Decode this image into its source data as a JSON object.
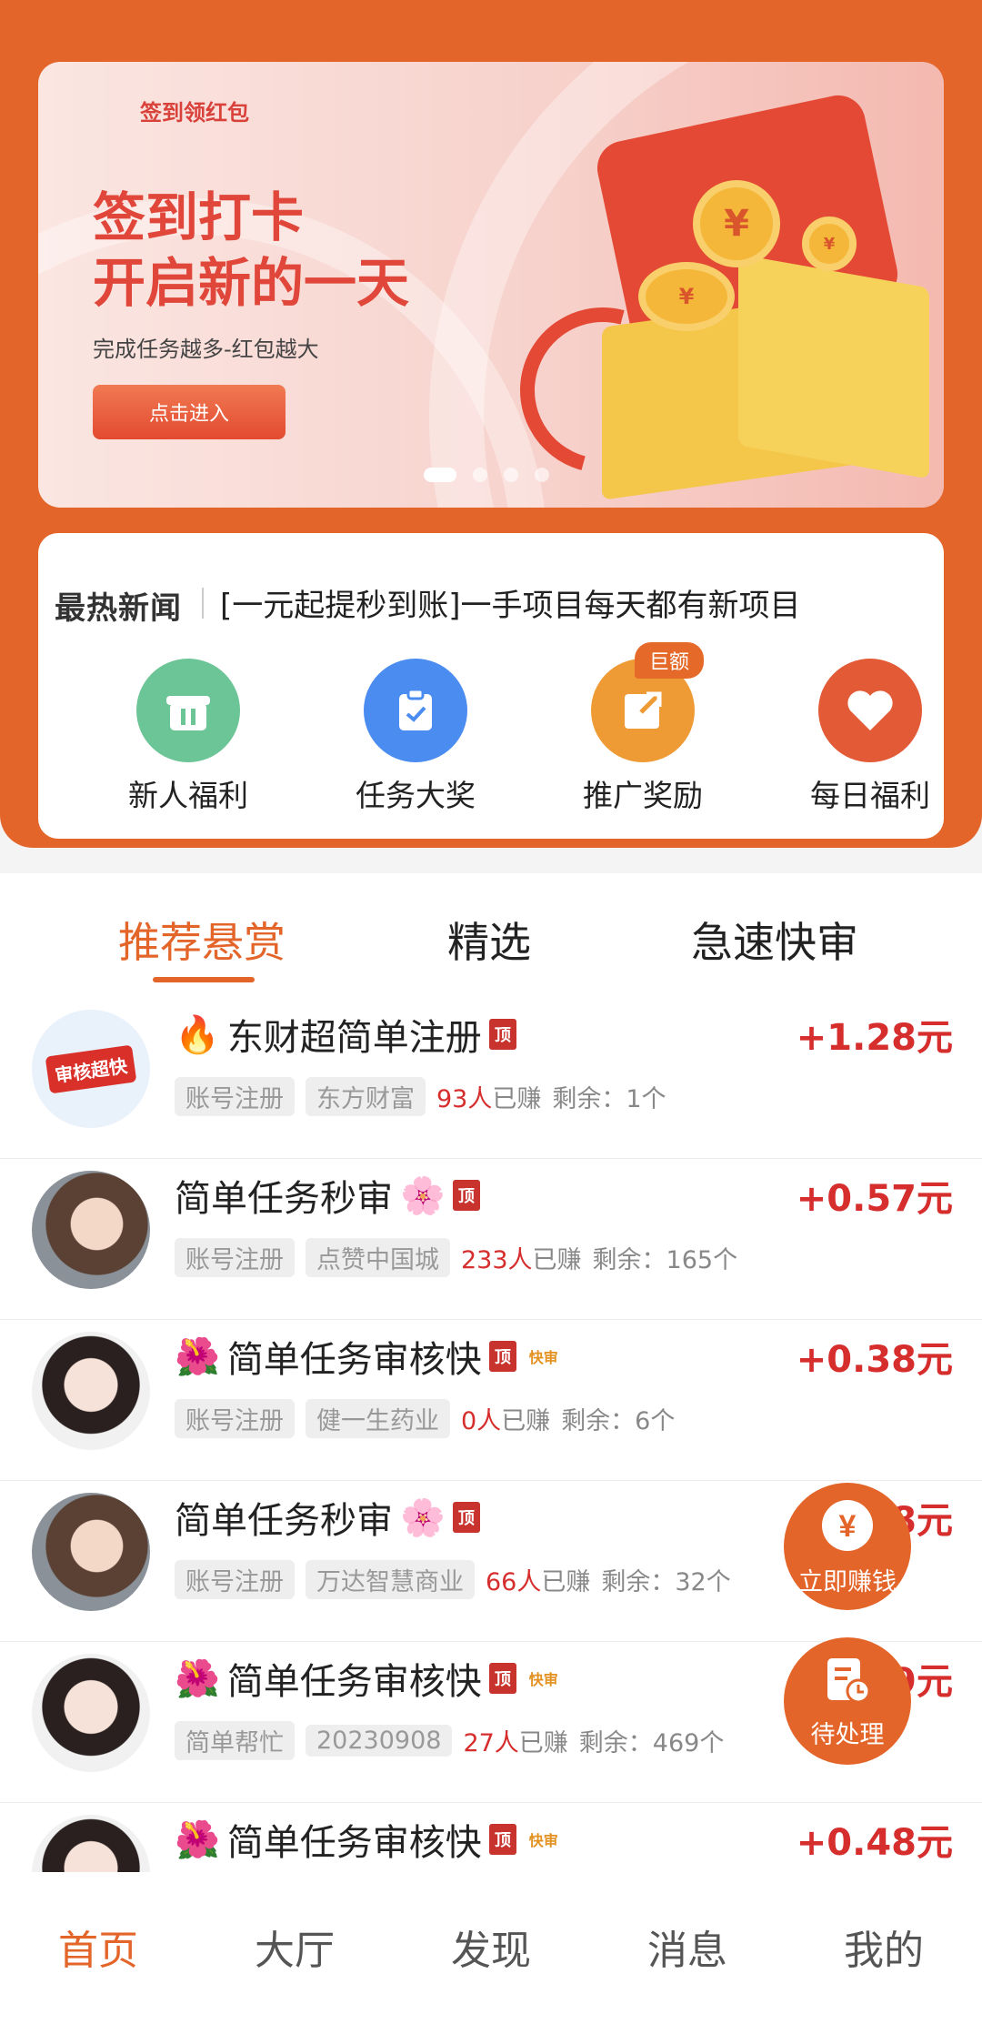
{
  "banner": {
    "tag": "签到领红包",
    "title_line1": "签到打卡",
    "title_line2": "开启新的一天",
    "subtitle": "完成任务越多-红包越大",
    "button": "点击进入",
    "coin_symbol": "¥",
    "slide_count": 4,
    "active_slide": 1
  },
  "news": {
    "label": "最热新闻",
    "text": "[一元起提秒到账]一手项目每天都有新项目"
  },
  "quick_actions": [
    {
      "label": "新人福利",
      "icon": "gift-icon",
      "color": "#6cc596"
    },
    {
      "label": "任务大奖",
      "icon": "clipboard-check-icon",
      "color": "#4a8cf0"
    },
    {
      "label": "推广奖励",
      "icon": "share-icon",
      "color": "#ee9a35",
      "badge": "巨额"
    },
    {
      "label": "每日福利",
      "icon": "heart-icon",
      "color": "#e35a36"
    }
  ],
  "tabs": [
    "推荐悬赏",
    "精选",
    "急速快审"
  ],
  "tasks": [
    {
      "prefix": "🔥",
      "title": "东财超简单注册",
      "suffix": "",
      "fast": false,
      "price": "+1.28元",
      "tag1": "账号注册",
      "tag2": "东方财富",
      "earned": "93人",
      "earned_label": "已赚",
      "remain": "剩余：1个",
      "avatar": "audit-fast-logo"
    },
    {
      "prefix": "",
      "title": "简单任务秒审",
      "suffix": "🌸",
      "fast": false,
      "price": "+0.57元",
      "tag1": "账号注册",
      "tag2": "点赞中国城",
      "earned": "233人",
      "earned_label": "已赚",
      "remain": "剩余：165个",
      "avatar": "girl-car-photo"
    },
    {
      "prefix": "🌺",
      "title": "简单任务审核快",
      "suffix": "",
      "fast": true,
      "price": "+0.38元",
      "tag1": "账号注册",
      "tag2": "健一生药业",
      "earned": "0人",
      "earned_label": "已赚",
      "remain": "剩余：6个",
      "avatar": "girl-lipstick-photo"
    },
    {
      "prefix": "",
      "title": "简单任务秒审",
      "suffix": "🌸",
      "fast": false,
      "price": "8元",
      "tag1": "账号注册",
      "tag2": "万达智慧商业",
      "earned": "66人",
      "earned_label": "已赚",
      "remain": "剩余：32个",
      "avatar": "girl-car-photo"
    },
    {
      "prefix": "🌺",
      "title": "简单任务审核快",
      "suffix": "",
      "fast": true,
      "price": "9元",
      "tag1": "简单帮忙",
      "tag2": "20230908",
      "earned": "27人",
      "earned_label": "已赚",
      "remain": "剩余：469个",
      "avatar": "girl-lipstick-photo"
    },
    {
      "prefix": "🌺",
      "title": "简单任务审核快",
      "suffix": "",
      "fast": true,
      "price": "+0.48元",
      "tag1": "",
      "tag2": "",
      "earned": "",
      "earned_label": "",
      "remain": "",
      "avatar": "girl-lipstick-photo"
    }
  ],
  "badges": {
    "top": "顶",
    "fast": "快审",
    "audit_logo": "审核超快"
  },
  "fabs": [
    {
      "label": "立即赚钱",
      "icon": "yen-coin-icon"
    },
    {
      "label": "待处理",
      "icon": "pending-doc-icon"
    }
  ],
  "nav": [
    "首页",
    "大厅",
    "发现",
    "消息",
    "我的"
  ],
  "colors": {
    "brand": "#e3652a",
    "price": "#d62d2d"
  }
}
